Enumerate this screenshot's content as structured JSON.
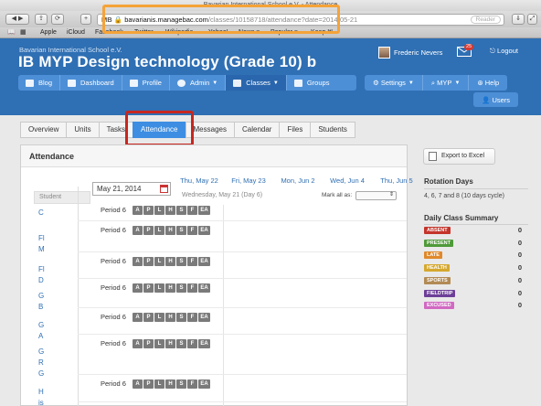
{
  "browser": {
    "window_title": "Bavarian International School e.V. - Attendance",
    "url_host": "bavarianis.managebac.com",
    "url_path": "/classes/10158718/attendance?date=2014-05-21",
    "url_prefix": "MB",
    "reader_label": "Reader",
    "bookmarks": [
      "Apple",
      "iCloud",
      "Facebook",
      "Twitter",
      "Wikipedia",
      "Yahoo!",
      "News ▾",
      "Popular ▾",
      "Keep It!"
    ]
  },
  "header": {
    "school": "Bavarian International School e.V.",
    "course_title": "IB MYP Design technology (Grade 10) b",
    "user_name": "Frederic Nevers",
    "mail_count": "25",
    "logout_label": "Logout",
    "nav": [
      {
        "label": "Blog",
        "icon": "blog-icon"
      },
      {
        "label": "Dashboard",
        "icon": "dashboard-icon"
      },
      {
        "label": "Profile",
        "icon": "profile-icon"
      },
      {
        "label": "Admin",
        "icon": "globe-icon"
      },
      {
        "label": "Classes",
        "icon": "classes-icon"
      },
      {
        "label": "Groups",
        "icon": "groups-icon"
      }
    ],
    "nav_right": [
      {
        "label": "Settings",
        "icon": "gear-icon"
      },
      {
        "label": "MYP",
        "icon": "search-icon"
      },
      {
        "label": "Help",
        "icon": "help-icon"
      }
    ],
    "users_label": "Users"
  },
  "subtabs": [
    "Overview",
    "Units",
    "Tasks",
    "Attendance",
    "Messages",
    "Calendar",
    "Files",
    "Students"
  ],
  "attendance": {
    "title": "Attendance",
    "date_value": "May 21, 2014",
    "date_columns": [
      "Thu, May 22",
      "Fri, May 23",
      "Mon, Jun 2",
      "Wed, Jun 4",
      "Thu, Jun 5"
    ],
    "day_info": "Wednesday, May 21 (Day 6)",
    "mark_all_label": "Mark all as:",
    "student_header": "Student",
    "period_label": "Period 6",
    "codes": [
      "A",
      "P",
      "L",
      "H",
      "S",
      "F",
      "EA"
    ],
    "students": [
      {
        "name": "C"
      },
      {
        "name": "Fl\nM"
      },
      {
        "name": "Fl\nD"
      },
      {
        "name": "G\nB"
      },
      {
        "name": "G\nA"
      },
      {
        "name": "G\nR\nG"
      },
      {
        "name": "H\nis"
      }
    ]
  },
  "side": {
    "export_label": "Export to Excel",
    "rotation_title": "Rotation Days",
    "rotation_text": "4, 6, 7 and 8 (10 days cycle)",
    "summary_title": "Daily Class Summary",
    "summary": [
      {
        "label": "ABSENT",
        "count": "0",
        "color": "#c4352b"
      },
      {
        "label": "PRESENT",
        "count": "0",
        "color": "#4f9a3a"
      },
      {
        "label": "LATE",
        "count": "0",
        "color": "#e0892b"
      },
      {
        "label": "HEALTH",
        "count": "0",
        "color": "#d5a82f"
      },
      {
        "label": "SPORTS",
        "count": "0",
        "color": "#b28a54"
      },
      {
        "label": "FIELDTRIP",
        "count": "0",
        "color": "#6d3f98"
      },
      {
        "label": "EXCUSED",
        "count": "0",
        "color": "#d169c2"
      }
    ]
  }
}
